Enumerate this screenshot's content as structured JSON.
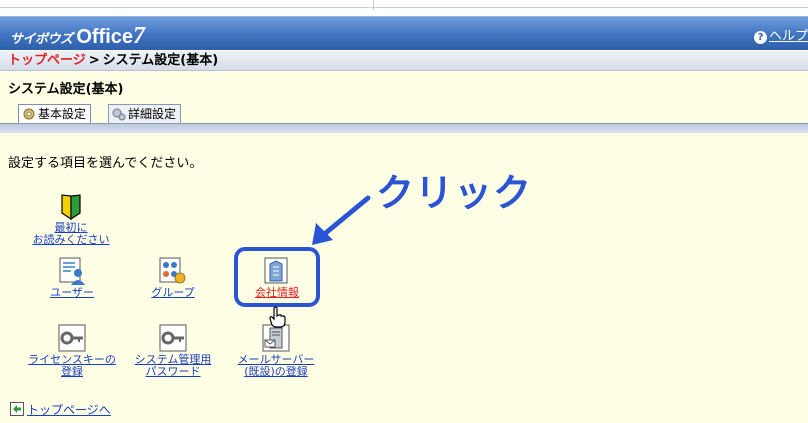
{
  "header": {
    "brand_small": "サイボウズ",
    "brand_big": "Office",
    "brand_version": "7",
    "help_label": "ヘルプ"
  },
  "breadcrumb": {
    "home": "トップページ",
    "separator": ">",
    "current": "システム設定(基本)"
  },
  "page": {
    "title": "システム設定(基本)",
    "instruction": "設定する項目を選んでください。"
  },
  "tabs": [
    {
      "label": "基本設定",
      "icon": "gear-icon",
      "active": true
    },
    {
      "label": "詳細設定",
      "icon": "gears-icon",
      "active": false
    }
  ],
  "items": {
    "first_read": {
      "line1": "最初に",
      "line2": "お読みください",
      "icon": "beginner-mark-icon"
    },
    "users": {
      "line1": "ユーザー",
      "icon": "user-icon"
    },
    "groups": {
      "line1": "グループ",
      "icon": "group-icon"
    },
    "company": {
      "line1": "会社情報",
      "icon": "building-icon"
    },
    "license": {
      "line1": "ライセンスキーの",
      "line2": "登録",
      "icon": "key-icon"
    },
    "sys_password": {
      "line1": "システム管理用",
      "line2": "パスワード",
      "icon": "key-icon"
    },
    "mail_server": {
      "line1": "メールサーバー",
      "line2": "(既設)の登録",
      "icon": "server-icon"
    }
  },
  "annotation": {
    "callout": "クリック",
    "color": "#2a54d4"
  },
  "footer": {
    "back_link": "トップページへ",
    "back_icon": "back-arrow-icon"
  }
}
